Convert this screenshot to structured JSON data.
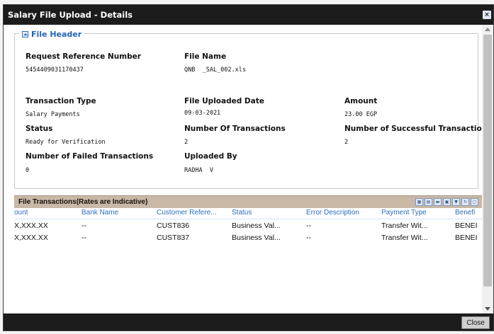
{
  "dialog": {
    "title": "Salary File Upload - Details",
    "close_icon": "×",
    "close_button": "Close"
  },
  "file_header": {
    "legend": "File Header",
    "fields": {
      "request_reference_number": {
        "label": "Request Reference Number",
        "value": "5454409031170437"
      },
      "file_name": {
        "label": "File Name",
        "value": "QNB  _SAL_002.xls"
      },
      "transaction_type": {
        "label": "Transaction Type",
        "value": "Salary Payments"
      },
      "file_uploaded_date": {
        "label": "File Uploaded Date",
        "value": "09-03-2021"
      },
      "amount": {
        "label": "Amount",
        "value": "23.00 EGP"
      },
      "status": {
        "label": "Status",
        "value": "Ready for Verification"
      },
      "number_of_transactions": {
        "label": "Number Of Transactions",
        "value": "2"
      },
      "number_of_successful_transactions": {
        "label": "Number of Successful Transactions",
        "value": "2"
      },
      "number_of_failed_transactions": {
        "label": "Number of Failed Transactions",
        "value": "0"
      },
      "uploaded_by": {
        "label": "Uploaded By",
        "value": "RADHA  V"
      }
    }
  },
  "transactions": {
    "title": "File Transactions(Rates are Indicative)",
    "columns": [
      "ount",
      "Bank Name",
      "Customer Refere...",
      "Status",
      "Error Description",
      "Payment Type",
      "Benefi"
    ],
    "rows": [
      [
        "X,XXX.XX",
        "--",
        "CUST836",
        "Business Val...",
        "--",
        "Transfer Wit...",
        "BENEI"
      ],
      [
        "X,XXX.XX",
        "--",
        "CUST837",
        "Business Val...",
        "--",
        "Transfer Wit...",
        "BENEI"
      ]
    ],
    "tools": [
      "excel-export-icon",
      "pdf-export-icon",
      "print-icon",
      "save-icon",
      "filter-icon",
      "refresh-icon",
      "settings-icon"
    ]
  },
  "colors": {
    "titlebar": "#1c1c1c",
    "legend_text": "#2266b5",
    "grid_header": "#c9b8a6",
    "column_header_text": "#2d6fb9"
  }
}
